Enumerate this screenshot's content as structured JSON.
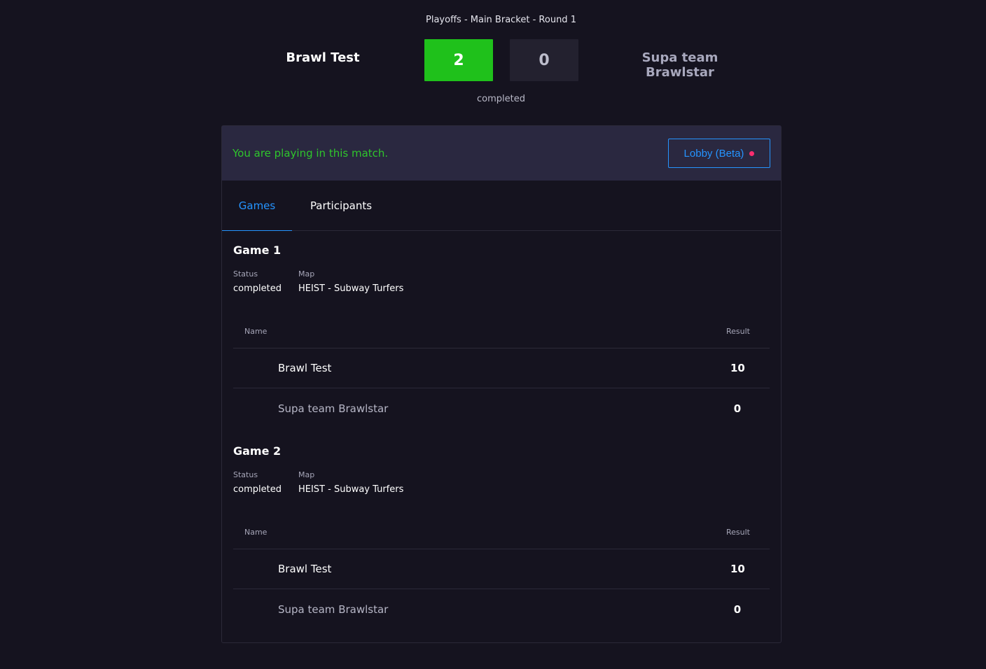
{
  "header": {
    "round_label": "Playoffs - Main Bracket - Round 1",
    "team_left": "Brawl Test",
    "team_right": "Supa team Brawlstar",
    "score_left": "2",
    "score_right": "0",
    "status": "completed"
  },
  "banner": {
    "message": "You are playing in this match.",
    "lobby_button": "Lobby (Beta)"
  },
  "tabs": [
    {
      "label": "Games",
      "active": true
    },
    {
      "label": "Participants",
      "active": false
    }
  ],
  "labels": {
    "status": "Status",
    "map": "Map",
    "name_col": "Name",
    "result_col": "Result"
  },
  "games": [
    {
      "title": "Game 1",
      "status": "completed",
      "map": "HEIST - Subway Turfers",
      "rows": [
        {
          "name": "Brawl Test",
          "result": "10"
        },
        {
          "name": "Supa team Brawlstar",
          "result": "0"
        }
      ]
    },
    {
      "title": "Game 2",
      "status": "completed",
      "map": "HEIST - Subway Turfers",
      "rows": [
        {
          "name": "Brawl Test",
          "result": "10"
        },
        {
          "name": "Supa team Brawlstar",
          "result": "0"
        }
      ]
    }
  ],
  "colors": {
    "background": "#15131f",
    "win_green": "#1fc11b",
    "accent_blue": "#2594ff",
    "live_dot": "#ff2d6f"
  }
}
